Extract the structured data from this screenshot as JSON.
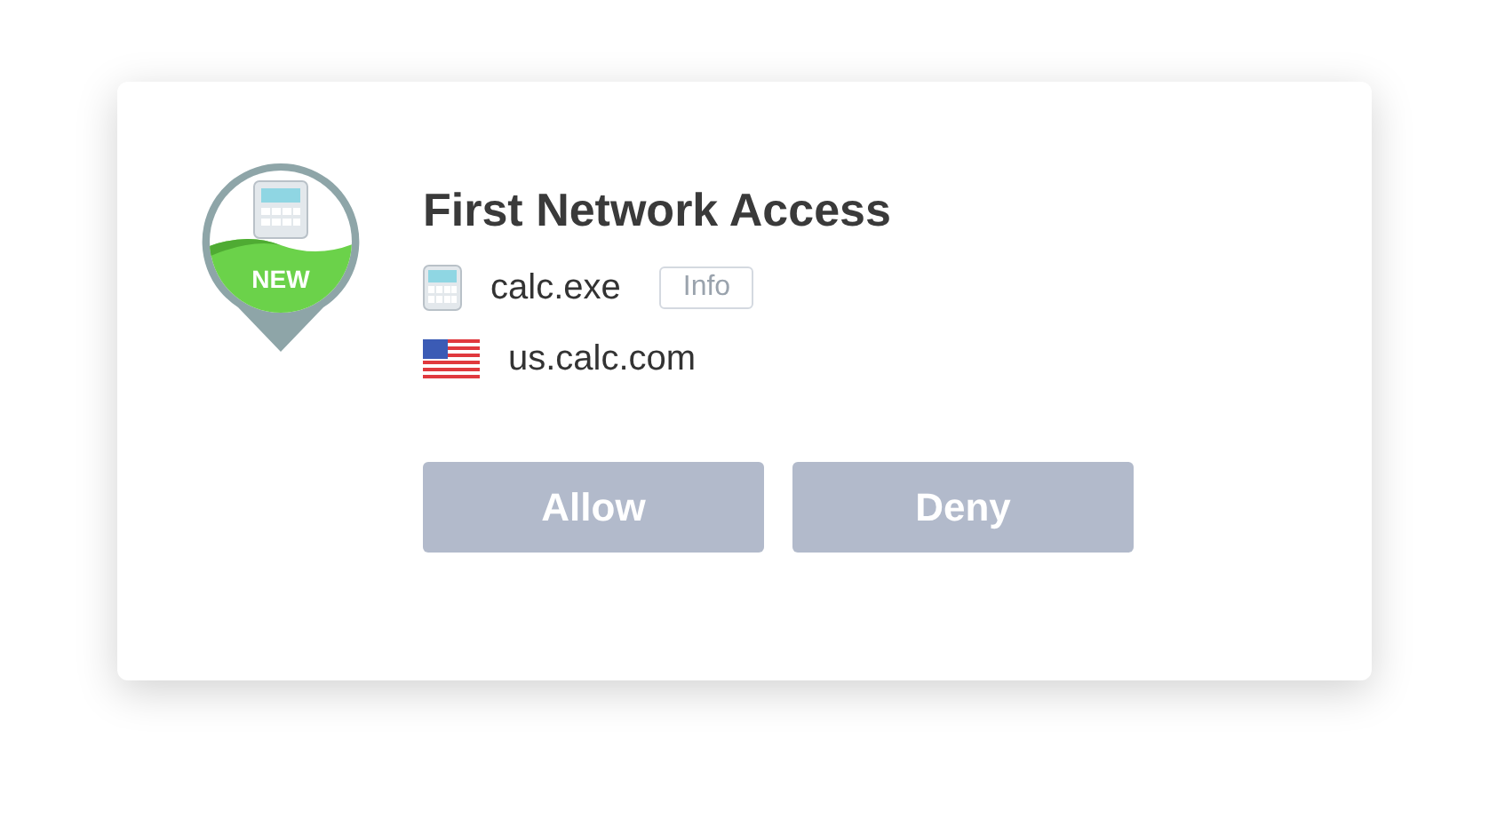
{
  "badge": {
    "label": "NEW"
  },
  "title": "First Network Access",
  "app": {
    "name": "calc.exe",
    "info_button": "Info"
  },
  "host": {
    "name": "us.calc.com"
  },
  "buttons": [
    {
      "label": "Allow"
    },
    {
      "label": "Deny"
    }
  ]
}
